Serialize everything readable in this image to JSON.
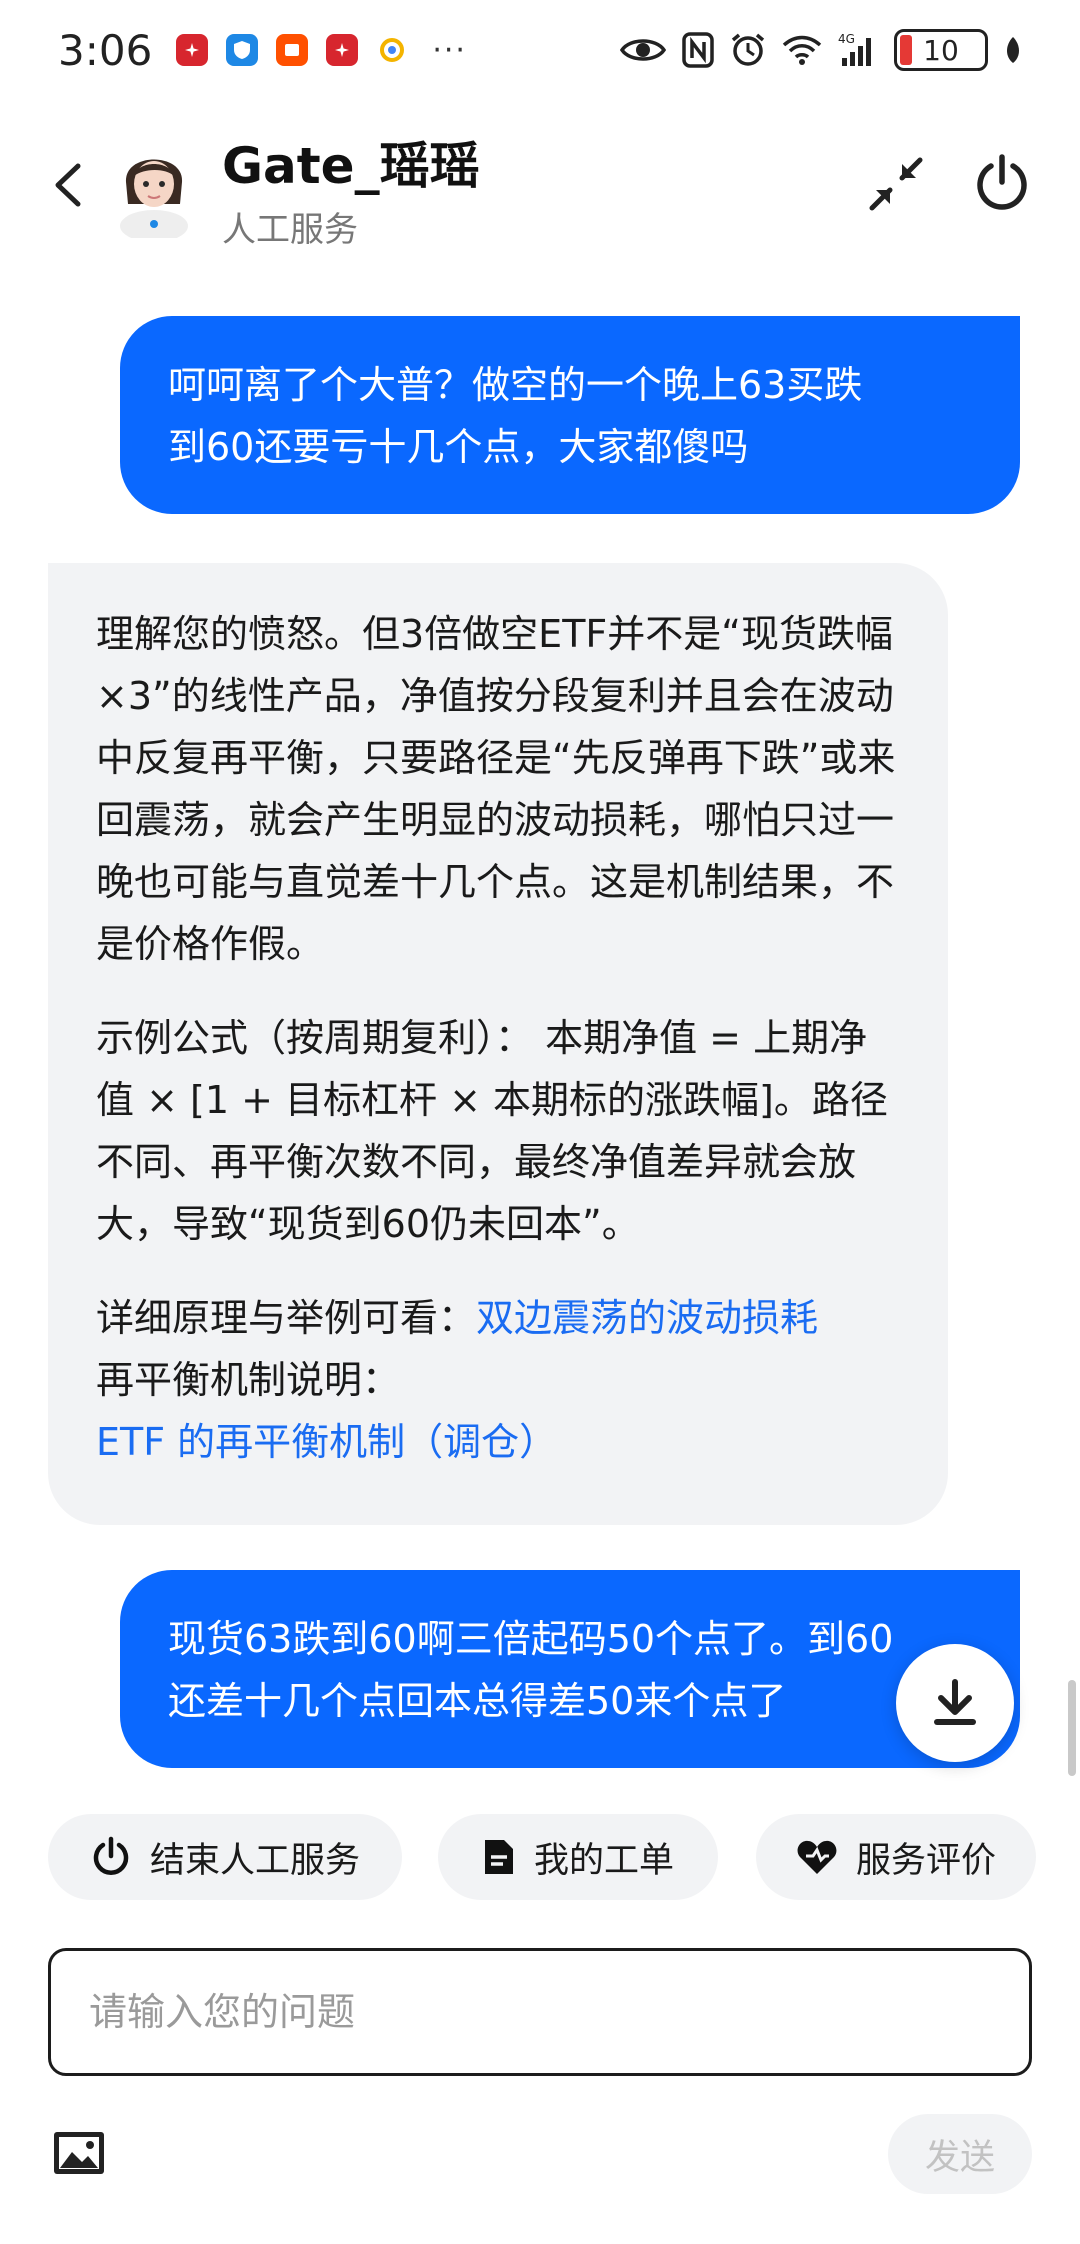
{
  "status_bar": {
    "time": "3:06",
    "notification_icons": [
      "huawei-app-icon",
      "shield-app-icon",
      "taobao-app-icon",
      "huawei-app-icon",
      "browser-app-icon"
    ],
    "more": "···",
    "battery_level": "10"
  },
  "header": {
    "agent_name": "Gate_瑶瑶",
    "agent_status": "人工服务"
  },
  "messages": {
    "user1_line1": "呵呵离了个大普？做空的一个晚上63买跌",
    "user1_line2": "到60还要亏十几个点，大家都傻吗",
    "agent_p1": "理解您的愤怒。但3倍做空ETF并不是“现货跌幅×3”的线性产品，净值按分段复利并且会在波动中反复再平衡，只要路径是“先反弹再下跌”或来回震荡，就会产生明显的波动损耗，哪怕只过一晚也可能与直觉差十几个点。这是机制结果，不是价格作假。",
    "agent_p2": "示例公式（按周期复利）： 本期净值 = 上期净值 × [1 + 目标杠杆 × 本期标的涨跌幅]。路径不同、再平衡次数不同，最终净值差异就会放大，导致“现货到60仍未回本”。",
    "agent_p3_prefix": "详细原理与举例可看：",
    "agent_link1": "双边震荡的波动损耗",
    "agent_p3_label2": "再平衡机制说明：",
    "agent_link2": "ETF 的再平衡机制（调仓）",
    "user2_line1": "现货63跌到60啊三倍起码50个点了。到60",
    "user2_line2": "还差十几个点回本总得差50来个点了"
  },
  "quick_actions": {
    "end_service": "结束人工服务",
    "my_tickets": "我的工单",
    "rate_service": "服务评价"
  },
  "input": {
    "placeholder": "请输入您的问题",
    "value": "",
    "send_label": "发送"
  },
  "colors": {
    "user_bubble": "#0a68ff",
    "agent_bubble": "#f2f3f5",
    "link": "#1a6cf2"
  }
}
